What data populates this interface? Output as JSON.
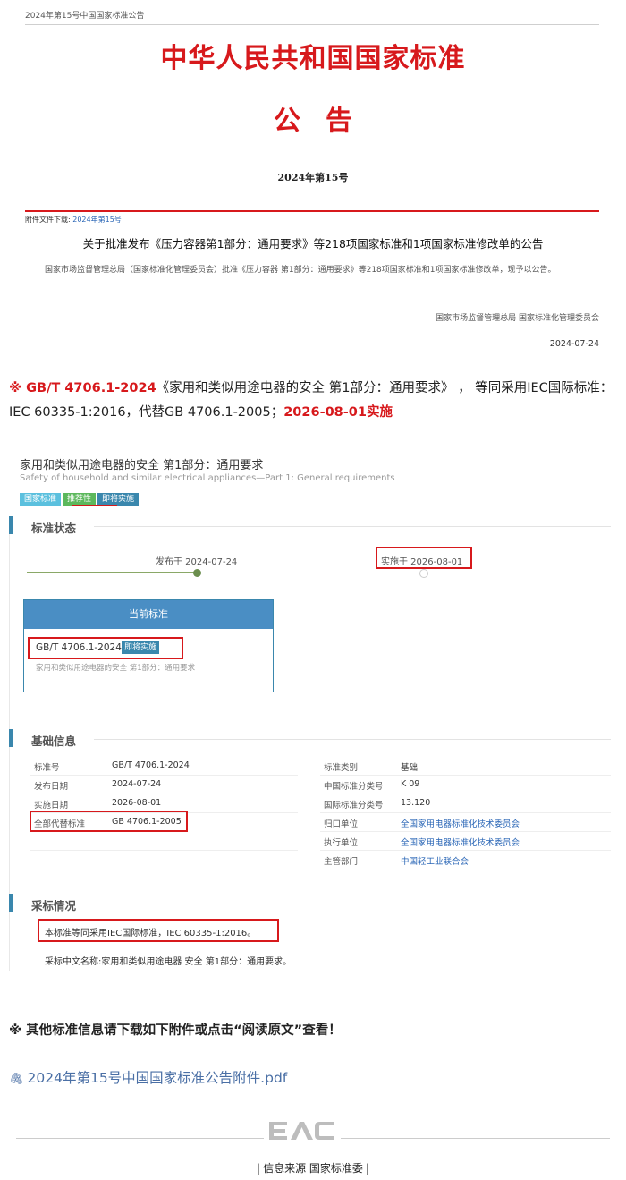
{
  "announcement": {
    "breadcrumb": "2024年第15号中国国家标准公告",
    "title": "中华人民共和国国家标准",
    "notice_word": "公告",
    "issue_no": "2024年第15号",
    "attachment_label": "附件文件下载:",
    "attachment_link": "2024年第15号",
    "heading": "关于批准发布《压力容器第1部分：通用要求》等218项国家标准和1项国家标准修改单的公告",
    "body": "国家市场监督管理总局（国家标准化管理委员会）批准《压力容器 第1部分：通用要求》等218项国家标准和1项国家标准修改单，现予以公告。",
    "signature": "国家市场监督管理总局 国家标准化管理委员会",
    "date": "2024-07-24"
  },
  "intro": {
    "prefix": "※ GB/T 4706.1-2024",
    "middle": "《家用和类似用途电器的安全 第1部分：通用要求》 ， 等同采用IEC国际标准：IEC 60335-1:2016，代替GB 4706.1-2005；",
    "effective": "2026-08-01实施"
  },
  "standard": {
    "title_cn": "家用和类似用途电器的安全 第1部分：通用要求",
    "title_en": "Safety of household and similar electrical appliances—Part 1: General requirements",
    "tags": [
      "国家标准",
      "推荐性",
      "即将实施"
    ],
    "status_section": "标准状态",
    "published": "发布于 2024-07-24",
    "implemented": "实施于 2026-08-01",
    "current_header": "当前标准",
    "current_code": "GB/T 4706.1-2024",
    "current_tag": "即将实施",
    "current_desc": "家用和类似用途电器的安全 第1部分：通用要求",
    "basic_section": "基础信息",
    "left_rows": [
      {
        "label": "标准号",
        "value": "GB/T 4706.1-2024"
      },
      {
        "label": "发布日期",
        "value": "2024-07-24"
      },
      {
        "label": "实施日期",
        "value": "2026-08-01"
      },
      {
        "label": "全部代替标准",
        "value": "GB 4706.1-2005"
      }
    ],
    "right_rows": [
      {
        "label": "标准类别",
        "value": "基础"
      },
      {
        "label": "中国标准分类号",
        "value": "K 09"
      },
      {
        "label": "国际标准分类号",
        "value": "13.120"
      },
      {
        "label": "归口单位",
        "value": "全国家用电器标准化技术委员会"
      },
      {
        "label": "执行单位",
        "value": "全国家用电器标准化技术委员会"
      },
      {
        "label": "主管部门",
        "value": "中国轻工业联合会"
      }
    ],
    "adopt_section": "采标情况",
    "adopt_text": "本标准等同采用IEC国际标准，IEC 60335-1:2016。",
    "adopt_cn_name": "采标中文名称:家用和类似用途电器 安全 第1部分：通用要求。"
  },
  "note": "※ 其他标准信息请下载如下附件或点击“阅读原文”查看！",
  "attachment_file": "2024年第15号中国国家标准公告附件.pdf",
  "footer": {
    "source": "信息来源  国家标准委",
    "logo_text": "EAC"
  },
  "colors": {
    "accent_red": "#d7191c",
    "link_blue": "#2a66b6",
    "section_blue": "#3a87ad"
  }
}
